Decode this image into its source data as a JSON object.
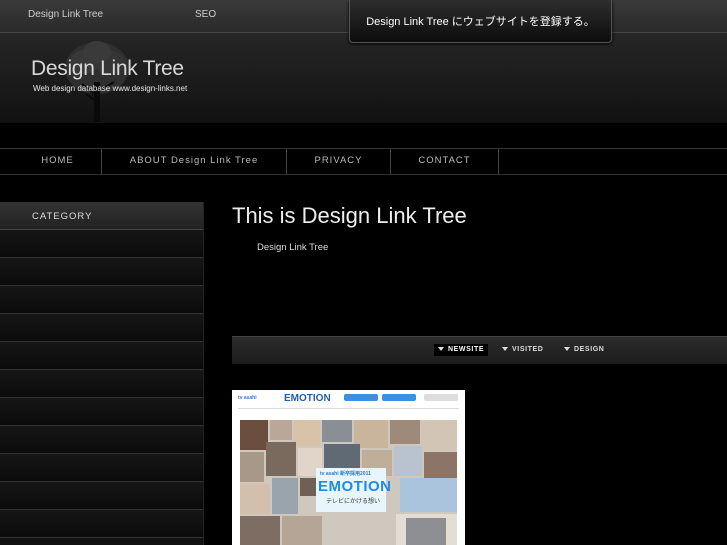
{
  "topbar": {
    "site_link": "Design Link Tree",
    "seo_link": "SEO"
  },
  "register_button": "Design Link Tree にウェブサイトを登録する。",
  "logo": {
    "title": "Design Link Tree",
    "subtitle": "Web design database  www.design-links.net"
  },
  "nav": [
    {
      "label": "HOME"
    },
    {
      "label": "ABOUT Design Link Tree"
    },
    {
      "label": "PRIVACY"
    },
    {
      "label": "CONTACT"
    }
  ],
  "sidebar": {
    "heading": "CATEGORY"
  },
  "main": {
    "title": "This is Design Link Tree",
    "subtitle": "Design Link Tree"
  },
  "tabs": [
    {
      "label": "NEWSITE",
      "active": true
    },
    {
      "label": "VISITED",
      "active": false
    },
    {
      "label": "DESIGN",
      "active": false
    }
  ],
  "thumbnail": {
    "brand": "tv asahi",
    "emotion_top": "EMOTION",
    "emotion_big": "EMOTION",
    "emotion_brand": "tv asahi 新卒採用2011",
    "emotion_jp": "テレビにかける想い"
  },
  "colors": {
    "background": "#000000",
    "accent": "#1e8be8"
  }
}
